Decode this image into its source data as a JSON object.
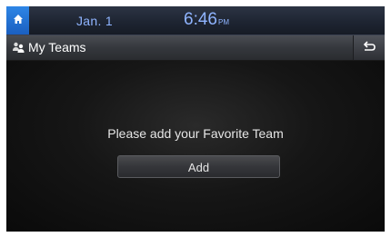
{
  "status_bar": {
    "home_icon": "home-icon",
    "date": "Jan.  1",
    "time": "6:46",
    "ampm": "PM"
  },
  "title_bar": {
    "icon": "team-icon",
    "title": "My Teams",
    "back_icon": "back-icon"
  },
  "main": {
    "message": "Please add your Favorite Team",
    "add_label": "Add"
  },
  "colors": {
    "accent_blue": "#2e86e6",
    "status_text": "#8fb4ff"
  }
}
